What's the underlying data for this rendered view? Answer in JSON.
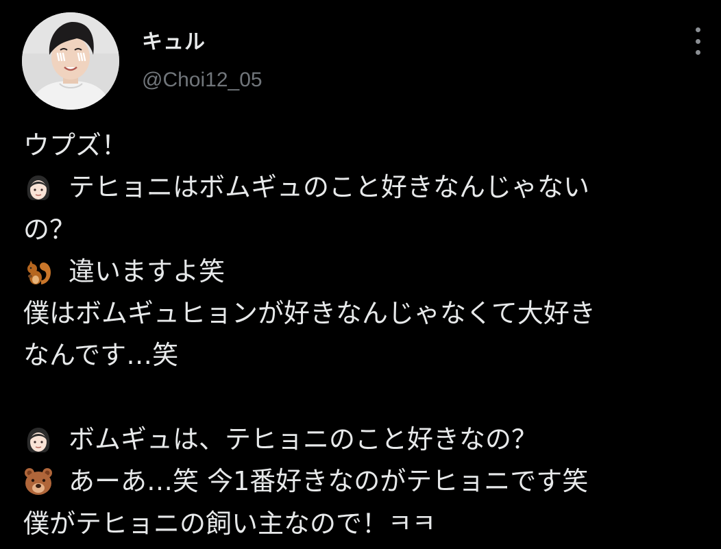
{
  "post": {
    "author": {
      "display_name": "キュル",
      "handle": "@Choi12_05"
    },
    "more_icon": "more-vertical-icon",
    "lines": [
      {
        "emoji": null,
        "text": "ウプズ！"
      },
      {
        "emoji": "woman-face-emoji",
        "text": "テヒョニはボムギュのこと好きなんじゃない"
      },
      {
        "emoji": null,
        "text": "の？"
      },
      {
        "emoji": "squirrel-emoji",
        "text": "違いますよ笑"
      },
      {
        "emoji": null,
        "text": "僕はボムギュヒョンが好きなんじゃなくて大好き"
      },
      {
        "emoji": null,
        "text": "なんです…笑"
      },
      {
        "emoji": null,
        "text": ""
      },
      {
        "emoji": "woman-face-emoji",
        "text": "ボムギュは、テヒョニのこと好きなの？"
      },
      {
        "emoji": "bear-face-emoji",
        "text": "あーあ…笑 今1番好きなのがテヒョニです笑"
      },
      {
        "emoji": null,
        "text": "僕がテヒョニの飼い主なので！ㅋㅋ"
      }
    ]
  },
  "colors": {
    "background": "#000000",
    "text_primary": "#e7e9ea",
    "text_secondary": "#71767b"
  }
}
